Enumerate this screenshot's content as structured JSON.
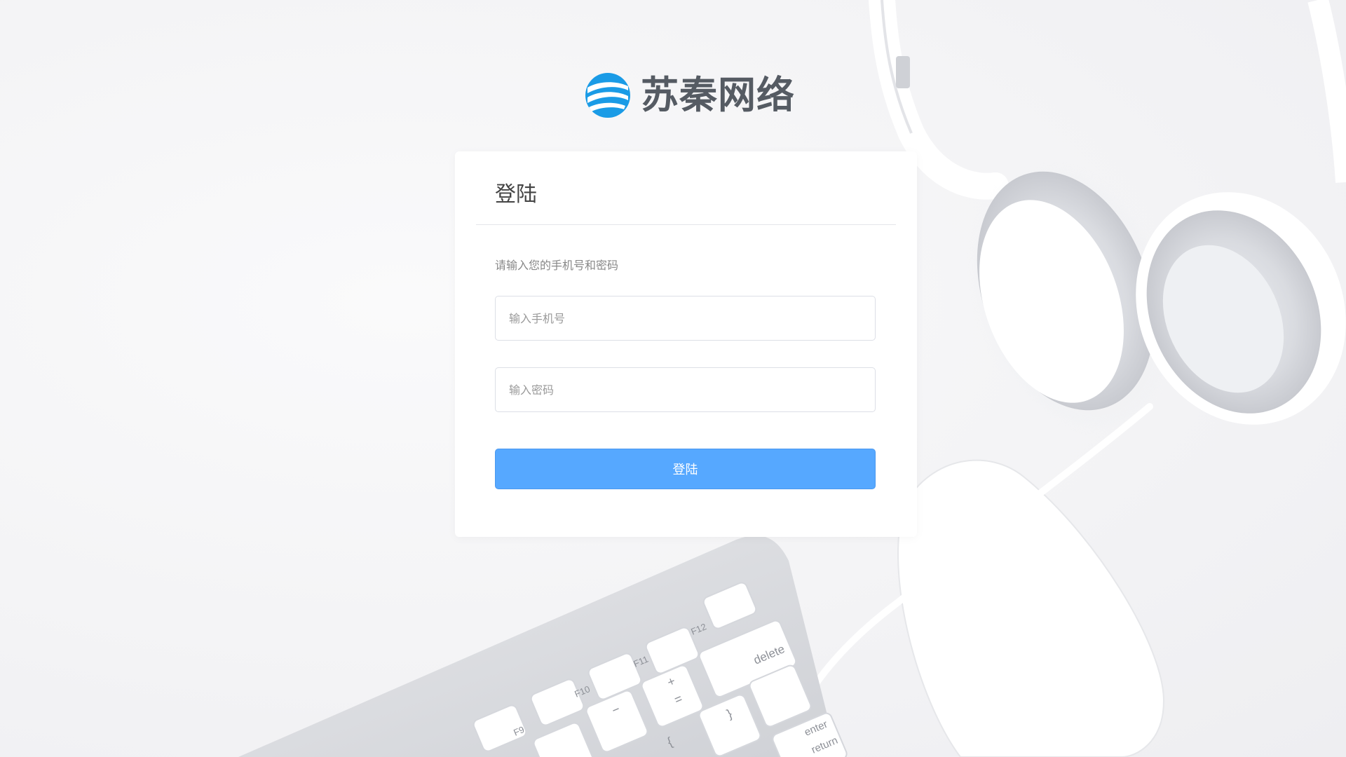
{
  "brand": {
    "name": "苏秦网络",
    "mark_color": "#1a9be6"
  },
  "login": {
    "title": "登陆",
    "hint": "请输入您的手机号和密码",
    "phone_placeholder": "输入手机号",
    "phone_value": "",
    "password_placeholder": "输入密码",
    "password_value": "",
    "submit_label": "登陆",
    "button_color": "#56a8ff"
  },
  "keyboard": {
    "keys": [
      "F9",
      "F10",
      "F11",
      "F12",
      "delete",
      "enter",
      "return",
      "+",
      "=",
      "−",
      "{",
      "}"
    ]
  }
}
